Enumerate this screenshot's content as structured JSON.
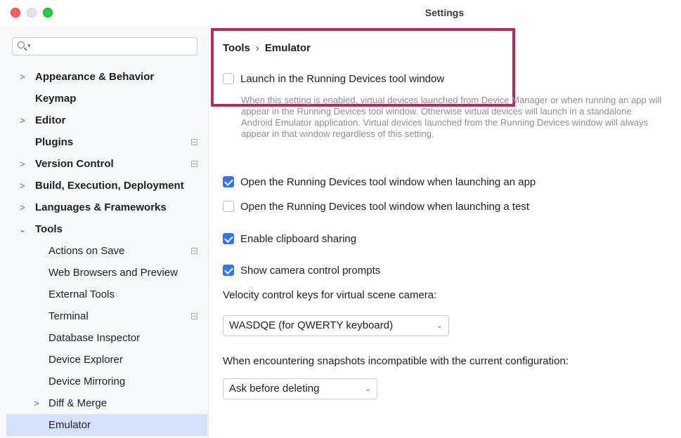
{
  "window": {
    "title": "Settings"
  },
  "search": {
    "placeholder": ""
  },
  "sidebar": {
    "items": [
      {
        "label": "Appearance & Behavior",
        "expander": ">",
        "badge": false
      },
      {
        "label": "Keymap",
        "expander": "",
        "badge": false
      },
      {
        "label": "Editor",
        "expander": ">",
        "badge": false
      },
      {
        "label": "Plugins",
        "expander": "",
        "badge": true
      },
      {
        "label": "Version Control",
        "expander": ">",
        "badge": true
      },
      {
        "label": "Build, Execution, Deployment",
        "expander": ">",
        "badge": false
      },
      {
        "label": "Languages & Frameworks",
        "expander": ">",
        "badge": false
      },
      {
        "label": "Tools",
        "expander": "⌄",
        "badge": false
      },
      {
        "label": "Actions on Save",
        "expander": "",
        "badge": true
      },
      {
        "label": "Web Browsers and Preview",
        "expander": "",
        "badge": false
      },
      {
        "label": "External Tools",
        "expander": "",
        "badge": false
      },
      {
        "label": "Terminal",
        "expander": "",
        "badge": true
      },
      {
        "label": "Database Inspector",
        "expander": "",
        "badge": false
      },
      {
        "label": "Device Explorer",
        "expander": "",
        "badge": false
      },
      {
        "label": "Device Mirroring",
        "expander": "",
        "badge": false
      },
      {
        "label": "Diff & Merge",
        "expander": ">",
        "badge": false
      },
      {
        "label": "Emulator",
        "expander": "",
        "badge": false,
        "selected": true
      }
    ]
  },
  "main": {
    "breadcrumb": {
      "parent": "Tools",
      "separator": "›",
      "current": "Emulator"
    },
    "launch_in_running_devices": {
      "label": "Launch in the Running Devices tool window",
      "checked": false
    },
    "launch_description": "When this setting is enabled, virtual devices launched from Device Manager or when running an app will appear in the Running Devices tool window. Otherwise virtual devices will launch in a standalone Android Emulator application. Virtual devices launched from the Running Devices window will always appear in that window regardless of this setting.",
    "open_when_launching_app": {
      "label": "Open the Running Devices tool window when launching an app",
      "checked": true
    },
    "open_when_launching_test": {
      "label": "Open the Running Devices tool window when launching a test",
      "checked": false
    },
    "clipboard_sharing": {
      "label": "Enable clipboard sharing",
      "checked": true
    },
    "camera_prompts": {
      "label": "Show camera control prompts",
      "checked": true
    },
    "velocity_label": "Velocity control keys for virtual scene camera:",
    "velocity_select": {
      "value": "WASDQE (for QWERTY keyboard)",
      "arrow": "⌄"
    },
    "snapshots_label": "When encountering snapshots incompatible with the current configuration:",
    "snapshots_select": {
      "value": "Ask before deleting",
      "arrow": "⌄"
    }
  },
  "colors": {
    "accent": "#3574f0",
    "highlight_frame": "#b52a5e",
    "selection": "#d4e2ff"
  }
}
